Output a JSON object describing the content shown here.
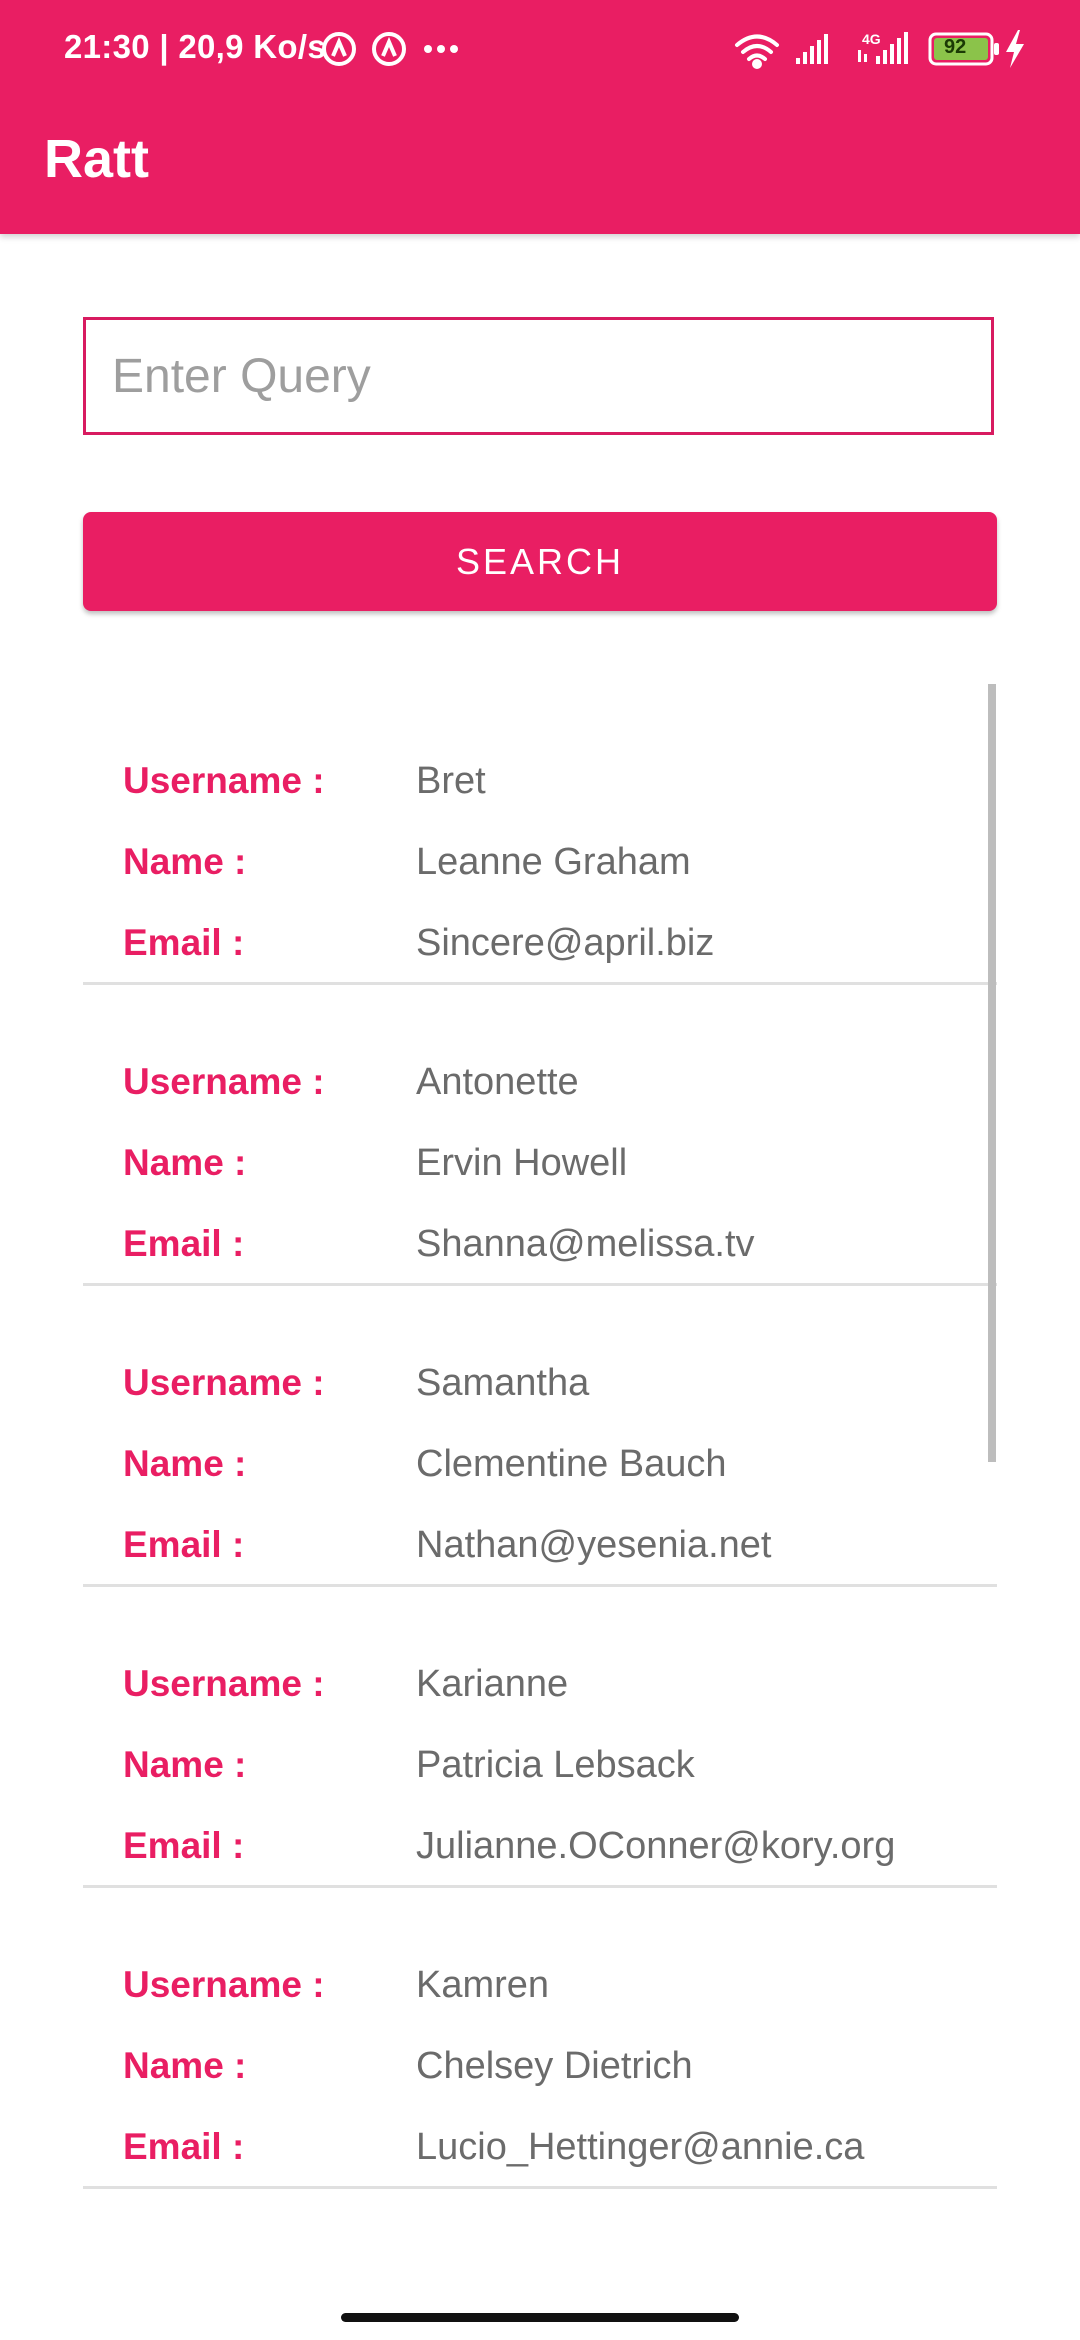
{
  "status_bar": {
    "time_text": "21:30 | 20,9 Ko/s",
    "battery": "92",
    "network": "4G",
    "more": "···"
  },
  "appbar": {
    "title": "Ratt"
  },
  "search": {
    "placeholder": "Enter Query",
    "button_label": "SEARCH"
  },
  "labels": {
    "username": "Username :",
    "name": "Name :",
    "email": "Email :"
  },
  "users": [
    {
      "username": "Bret",
      "name": "Leanne Graham",
      "email": "Sincere@april.biz"
    },
    {
      "username": "Antonette",
      "name": "Ervin Howell",
      "email": "Shanna@melissa.tv"
    },
    {
      "username": "Samantha",
      "name": "Clementine Bauch",
      "email": "Nathan@yesenia.net"
    },
    {
      "username": "Karianne",
      "name": "Patricia Lebsack",
      "email": "Julianne.OConner@kory.org"
    },
    {
      "username": "Kamren",
      "name": "Chelsey Dietrich",
      "email": "Lucio_Hettinger@annie.ca"
    }
  ],
  "colors": {
    "accent": "#E91E63",
    "value_text": "#6b6b6b",
    "divider": "#e0e0e0"
  }
}
